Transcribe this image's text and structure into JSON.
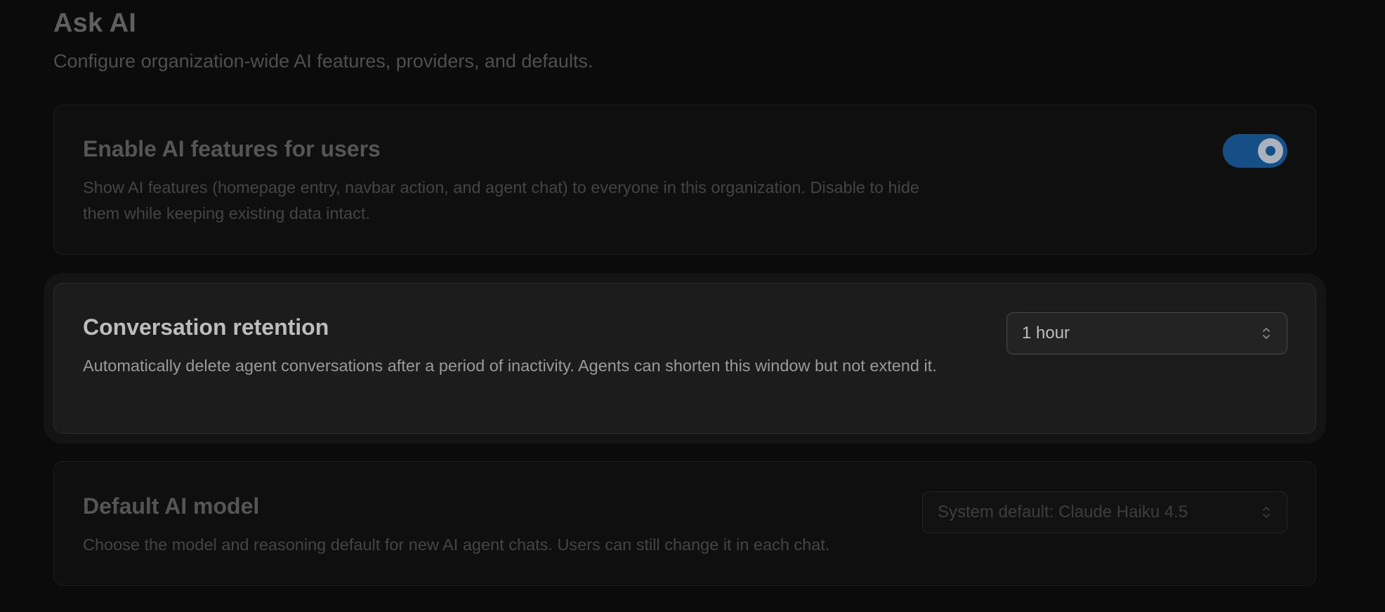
{
  "header": {
    "title": "Ask AI",
    "subtitle": "Configure organization-wide AI features, providers, and defaults."
  },
  "settings": {
    "enable_ai": {
      "title": "Enable AI features for users",
      "description": "Show AI features (homepage entry, navbar action, and agent chat) to everyone in this organization. Disable to hide them while keeping existing data intact.",
      "enabled": true
    },
    "retention": {
      "title": "Conversation retention",
      "description": "Automatically delete agent conversations after a period of inactivity. Agents can shorten this window but not extend it.",
      "selected": "1 hour"
    },
    "default_model": {
      "title": "Default AI model",
      "description": "Choose the model and reasoning default for new AI agent chats. Users can still change it in each chat.",
      "selected": "System default: Claude Haiku 4.5"
    }
  },
  "icons": {
    "select_chevron": "chevron-up-down-icon"
  },
  "colors": {
    "accent": "#154f86",
    "background": "#0b0b0b",
    "active_card": "#1c1c1c"
  }
}
